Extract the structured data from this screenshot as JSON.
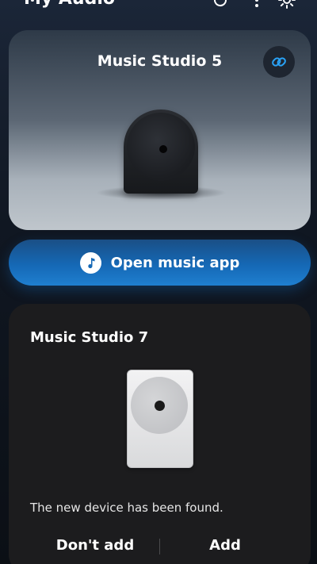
{
  "header": {
    "title": "My Audio",
    "icons": [
      "refresh-icon",
      "more-icon",
      "gear-icon"
    ]
  },
  "current_device": {
    "name": "Music Studio 5",
    "link_icon": "link-icon",
    "accent_color": "#2aa2f5"
  },
  "open_app_button": {
    "label": "Open music app",
    "icon": "music-note-icon",
    "color": "#1568b5"
  },
  "new_device": {
    "name": "Music Studio 7",
    "message": "The new device has been found.",
    "dont_add_label": "Don't add",
    "add_label": "Add"
  }
}
